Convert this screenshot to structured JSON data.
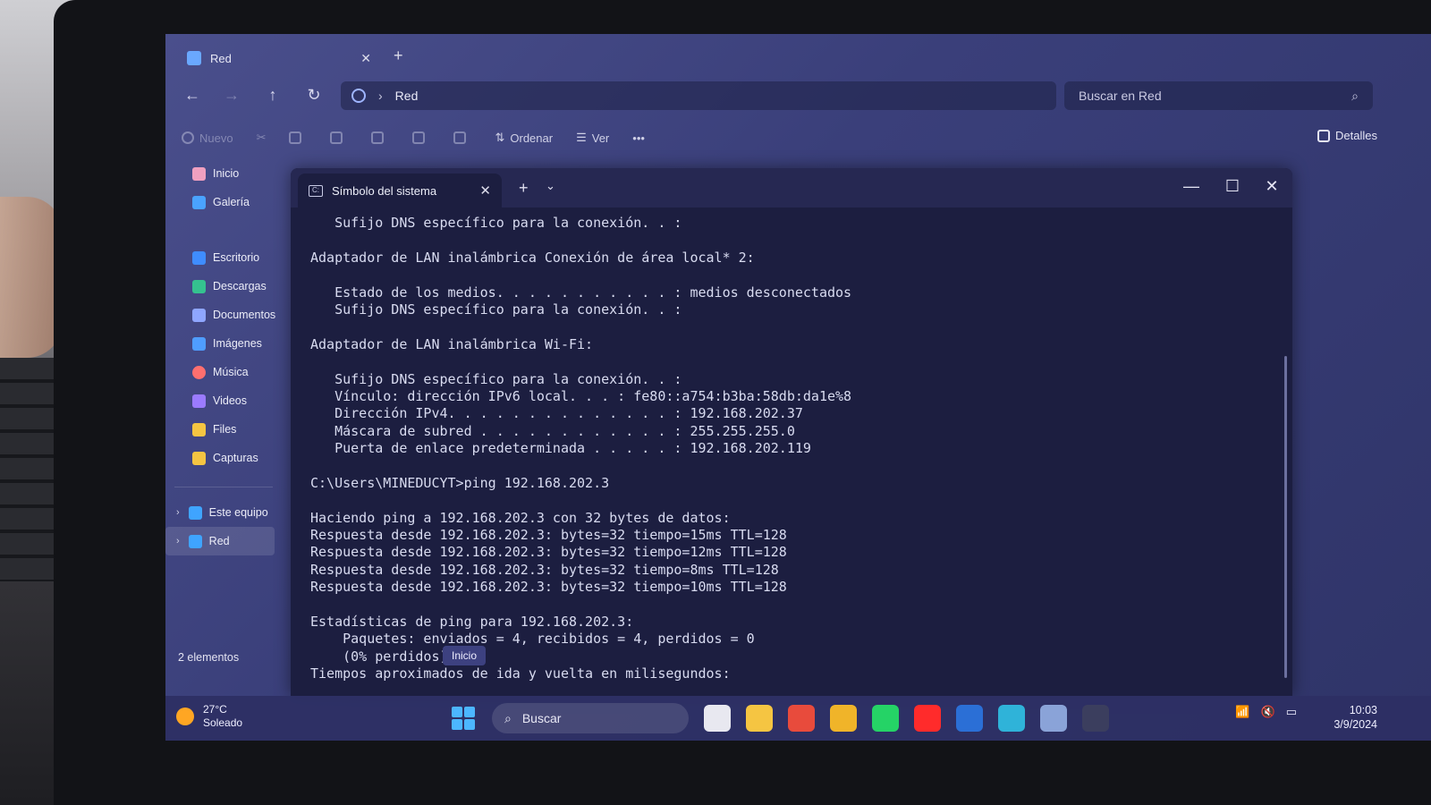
{
  "explorer": {
    "tab_title": "Red",
    "tab_close": "✕",
    "new_tab": "+",
    "nav": {
      "back": "←",
      "forward": "→",
      "up": "↑",
      "refresh": "↻"
    },
    "address": {
      "chevron": "›",
      "location": "Red"
    },
    "search_placeholder": "Buscar en Red",
    "toolbar": {
      "new": "Nuevo",
      "sort": "Ordenar",
      "view": "Ver",
      "more": "•••",
      "details": "Detalles"
    },
    "sidebar": {
      "quick": [
        {
          "label": "Inicio",
          "color": "#f0a0c0"
        },
        {
          "label": "Galería",
          "color": "#4aa3ff"
        }
      ],
      "pinned": [
        {
          "label": "Escritorio",
          "color": "#3f8dff"
        },
        {
          "label": "Descargas",
          "color": "#35c28f"
        },
        {
          "label": "Documentos",
          "color": "#8fa6ff"
        },
        {
          "label": "Imágenes",
          "color": "#4f9dff"
        },
        {
          "label": "Música",
          "color": "#ff6f6f"
        },
        {
          "label": "Videos",
          "color": "#9b7bff"
        },
        {
          "label": "Files",
          "color": "#f5c542"
        },
        {
          "label": "Capturas",
          "color": "#f5c542"
        }
      ],
      "tree": [
        {
          "label": "Este equipo",
          "color": "#3fa4ff"
        },
        {
          "label": "Red",
          "color": "#3fa4ff"
        }
      ]
    },
    "status": "2 elementos"
  },
  "terminal": {
    "tab_title": "Símbolo del sistema",
    "tab_close": "✕",
    "new_tab": "+",
    "dropdown": "⌄",
    "controls": {
      "minimize": "—",
      "maximize": "☐",
      "close": "✕"
    },
    "lines": [
      "   Sufijo DNS específico para la conexión. . :",
      "",
      "Adaptador de LAN inalámbrica Conexión de área local* 2:",
      "",
      "   Estado de los medios. . . . . . . . . . . : medios desconectados",
      "   Sufijo DNS específico para la conexión. . :",
      "",
      "Adaptador de LAN inalámbrica Wi-Fi:",
      "",
      "   Sufijo DNS específico para la conexión. . :",
      "   Vínculo: dirección IPv6 local. . . : fe80::a754:b3ba:58db:da1e%8",
      "   Dirección IPv4. . . . . . . . . . . . . . : 192.168.202.37",
      "   Máscara de subred . . . . . . . . . . . . : 255.255.255.0",
      "   Puerta de enlace predeterminada . . . . . : 192.168.202.119",
      "",
      "C:\\Users\\MINEDUCYT>ping 192.168.202.3",
      "",
      "Haciendo ping a 192.168.202.3 con 32 bytes de datos:",
      "Respuesta desde 192.168.202.3: bytes=32 tiempo=15ms TTL=128",
      "Respuesta desde 192.168.202.3: bytes=32 tiempo=12ms TTL=128",
      "Respuesta desde 192.168.202.3: bytes=32 tiempo=8ms TTL=128",
      "Respuesta desde 192.168.202.3: bytes=32 tiempo=10ms TTL=128",
      "",
      "Estadísticas de ping para 192.168.202.3:",
      "    Paquetes: enviados = 4, recibidos = 4, perdidos = 0",
      "    (0% perdidos),",
      "Tiempos aproximados de ida y vuelta en milisegundos:"
    ]
  },
  "tooltip": "Inicio",
  "taskbar": {
    "weather_temp": "27°C",
    "weather_desc": "Soleado",
    "search_placeholder": "Buscar",
    "apps": [
      {
        "name": "task-view",
        "color": "#e8e8f0"
      },
      {
        "name": "file-explorer",
        "color": "#f5c542"
      },
      {
        "name": "chrome",
        "color": "#e84b3c"
      },
      {
        "name": "chrome-2",
        "color": "#f0b429"
      },
      {
        "name": "whatsapp",
        "color": "#25d366"
      },
      {
        "name": "youtube",
        "color": "#ff2b2b"
      },
      {
        "name": "word",
        "color": "#2b6fd6"
      },
      {
        "name": "edge",
        "color": "#2fb3d9"
      },
      {
        "name": "settings",
        "color": "#8aa3d8"
      },
      {
        "name": "terminal",
        "color": "#3b3e5e"
      }
    ],
    "time": "10:03",
    "date": "3/9/2024"
  }
}
